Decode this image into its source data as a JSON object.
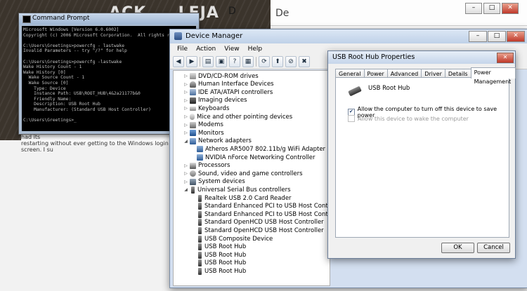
{
  "background": {
    "header_text": "ACK ... LEJA",
    "partial_title": "D",
    "right_title": "De",
    "lower_text_1": "night. To make matters worse one PC, which had recently had its",
    "lower_text_2": "restarting without ever getting to the Windows login screen. I su"
  },
  "browser_caps": {
    "min": "–",
    "max": "□",
    "close": "✕"
  },
  "cmd": {
    "title": "Command Prompt",
    "lines": [
      "Microsoft Windows [Version 6.0.6002]",
      "Copyright (c) 2006 Microsoft Corporation.  All rights reserved.",
      "",
      "C:\\Users\\Greetings>powercfg - lastwake",
      "Invalid Parameters -- try \"/?\" for help",
      "",
      "C:\\Users\\Greetings>powercfg -lastwake",
      "Wake History Count - 1",
      "Wake History [0]",
      "  Wake Source Count - 1",
      "  Wake Source [0]",
      "    Type: Device",
      "    Instance Path: USB\\ROOT_HUB\\4&2a21177b&0",
      "    Friendly Name:",
      "    Description: USB Root Hub",
      "    Manufacturer: (Standard USB Host Controller)",
      "",
      "C:\\Users\\Greetings>_"
    ]
  },
  "device_manager": {
    "title": "Device Manager",
    "menu": [
      "File",
      "Action",
      "View",
      "Help"
    ],
    "tree": [
      {
        "label": "DVD/CD-ROM drives",
        "icon": "disk-icon",
        "expander": "▷",
        "level": 0
      },
      {
        "label": "Human Interface Devices",
        "icon": "hid-icon",
        "expander": "▷",
        "level": 0
      },
      {
        "label": "IDE ATA/ATAPI controllers",
        "icon": "ide-icon",
        "expander": "▷",
        "level": 0
      },
      {
        "label": "Imaging devices",
        "icon": "camera-icon",
        "expander": "▷",
        "level": 0
      },
      {
        "label": "Keyboards",
        "icon": "keyboard-icon",
        "expander": "▷",
        "level": 0
      },
      {
        "label": "Mice and other pointing devices",
        "icon": "mouse-icon",
        "expander": "▷",
        "level": 0
      },
      {
        "label": "Modems",
        "icon": "modem-icon",
        "expander": "▷",
        "level": 0
      },
      {
        "label": "Monitors",
        "icon": "monitor-icon",
        "expander": "▷",
        "level": 0
      },
      {
        "label": "Network adapters",
        "icon": "network-icon",
        "expander": "◢",
        "level": 0
      },
      {
        "label": "Atheros AR5007 802.11b/g WiFi Adapter",
        "icon": "network-icon",
        "expander": "",
        "level": 1
      },
      {
        "label": "NVIDIA nForce Networking Controller",
        "icon": "network-icon",
        "expander": "",
        "level": 1
      },
      {
        "label": "Processors",
        "icon": "processor-icon",
        "expander": "▷",
        "level": 0
      },
      {
        "label": "Sound, video and game controllers",
        "icon": "sound-icon",
        "expander": "▷",
        "level": 0
      },
      {
        "label": "System devices",
        "icon": "system-icon",
        "expander": "▷",
        "level": 0
      },
      {
        "label": "Universal Serial Bus controllers",
        "icon": "usb-icon",
        "expander": "◢",
        "level": 0
      },
      {
        "label": "Realtek USB 2.0 Card Reader",
        "icon": "usb-icon",
        "expander": "",
        "level": 1
      },
      {
        "label": "Standard Enhanced PCI to USB Host Controller",
        "icon": "usb-icon",
        "expander": "",
        "level": 1
      },
      {
        "label": "Standard Enhanced PCI to USB Host Controller",
        "icon": "usb-icon",
        "expander": "",
        "level": 1
      },
      {
        "label": "Standard OpenHCD USB Host Controller",
        "icon": "usb-icon",
        "expander": "",
        "level": 1
      },
      {
        "label": "Standard OpenHCD USB Host Controller",
        "icon": "usb-icon",
        "expander": "",
        "level": 1
      },
      {
        "label": "USB Composite Device",
        "icon": "usb-icon",
        "expander": "",
        "level": 1
      },
      {
        "label": "USB Root Hub",
        "icon": "usb-icon",
        "expander": "",
        "level": 1
      },
      {
        "label": "USB Root Hub",
        "icon": "usb-icon",
        "expander": "",
        "level": 1
      },
      {
        "label": "USB Root Hub",
        "icon": "usb-icon",
        "expander": "",
        "level": 1
      },
      {
        "label": "USB Root Hub",
        "icon": "usb-icon",
        "expander": "",
        "level": 1
      }
    ]
  },
  "properties": {
    "title": "USB Root Hub Properties",
    "close": "✕",
    "tabs": [
      "General",
      "Power",
      "Advanced",
      "Driver",
      "Details",
      "Power Management"
    ],
    "active_tab": "Power Management",
    "device_name": "USB Root Hub",
    "allow_turn_off": {
      "label": "Allow the computer to turn off this device to save power",
      "checked": true
    },
    "allow_wake": {
      "label": "Allow this device to wake the computer",
      "checked": false,
      "disabled": true
    },
    "ok": "OK",
    "cancel": "Cancel"
  }
}
